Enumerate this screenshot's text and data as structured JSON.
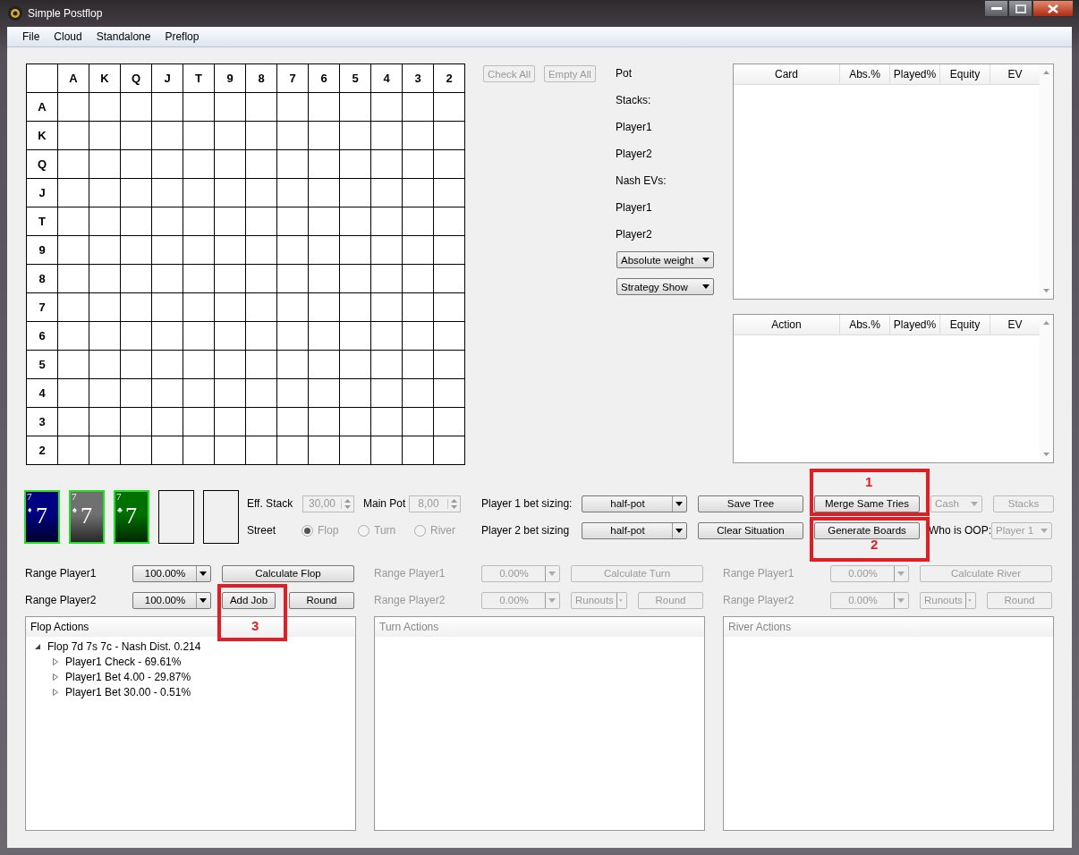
{
  "window": {
    "title": "Simple Postflop"
  },
  "menu": [
    "File",
    "Cloud",
    "Standalone",
    "Preflop"
  ],
  "grid": {
    "columns": [
      "A",
      "K",
      "Q",
      "J",
      "T",
      "9",
      "8",
      "7",
      "6",
      "5",
      "4",
      "3",
      "2"
    ],
    "rows": [
      "A",
      "K",
      "Q",
      "J",
      "T",
      "9",
      "8",
      "7",
      "6",
      "5",
      "4",
      "3",
      "2"
    ]
  },
  "grid_buttons": [
    {
      "label": "Check All",
      "disabled": true
    },
    {
      "label": "Empty All",
      "disabled": true
    }
  ],
  "info_labels": [
    "Pot",
    "Stacks:",
    "Player1",
    "Player2",
    "Nash EVs:",
    "Player1",
    "Player2"
  ],
  "view_dropdowns": [
    "Absolute weight",
    "Strategy Show"
  ],
  "card_table": {
    "columns": [
      "Card",
      "Abs.%",
      "Played%",
      "Equity",
      "EV"
    ]
  },
  "action_table": {
    "columns": [
      "Action",
      "Abs.%",
      "Played%",
      "Equity",
      "EV"
    ]
  },
  "board": [
    {
      "kind": "card",
      "corner": "7",
      "suit": "♦",
      "rank": "7",
      "color": "#000080"
    },
    {
      "kind": "card",
      "corner": "7",
      "suit": "♠",
      "rank": "7",
      "color": "#707070"
    },
    {
      "kind": "card",
      "corner": "7",
      "suit": "♣",
      "rank": "7",
      "color": "#007000"
    },
    {
      "kind": "empty"
    },
    {
      "kind": "empty"
    }
  ],
  "eff_stack": {
    "label": "Eff. Stack",
    "value": "30,00",
    "disabled": true
  },
  "main_pot": {
    "label": "Main Pot",
    "value": "8,00",
    "disabled": true
  },
  "street": {
    "label": "Street",
    "options": [
      {
        "label": "Flop",
        "selected": true,
        "disabled": true
      },
      {
        "label": "Turn",
        "selected": false,
        "disabled": true
      },
      {
        "label": "River",
        "selected": false,
        "disabled": true
      }
    ]
  },
  "bet_rows": [
    {
      "label": "Player 1 bet sizing:",
      "value": "half-pot",
      "button": "Save Tree",
      "board_button": "Merge Same Tries"
    },
    {
      "label": "Player 2 bet sizing",
      "value": "half-pot",
      "button": "Clear Situation",
      "board_button": "Generate Boards"
    }
  ],
  "game_type": {
    "value": "Cash",
    "disabled": true
  },
  "stacks_button": {
    "label": "Stacks",
    "disabled": true
  },
  "oop": {
    "label": "Who is OOP:",
    "value": "Player 1",
    "disabled": true
  },
  "streets": [
    {
      "disabled": false,
      "ranges": [
        {
          "label": "Range Player1",
          "value": "100.00%"
        },
        {
          "label": "Range Player2",
          "value": "100.00%"
        }
      ],
      "calculate": "Calculate Flop",
      "add_job": "Add Job",
      "round": "Round",
      "panel_title": "Flop Actions",
      "tree": [
        {
          "label": "Flop 7d 7s 7c - Nash Dist. 0.214",
          "expanded": true,
          "children": [
            {
              "label": "Player1 Check - 69.61%",
              "expanded": false
            },
            {
              "label": "Player1 Bet 4.00 - 29.87%",
              "expanded": false
            },
            {
              "label": "Player1 Bet 30.00 - 0.51%",
              "expanded": false
            }
          ]
        }
      ]
    },
    {
      "disabled": true,
      "ranges": [
        {
          "label": "Range Player1",
          "value": "0.00%"
        },
        {
          "label": "Range Player2",
          "value": "0.00%"
        }
      ],
      "calculate": "Calculate Turn",
      "runouts": "Runouts",
      "round": "Round",
      "panel_title": "Turn Actions"
    },
    {
      "disabled": true,
      "ranges": [
        {
          "label": "Range Player1",
          "value": "0.00%"
        },
        {
          "label": "Range Player2",
          "value": "0.00%"
        }
      ],
      "calculate": "Calculate River",
      "runouts": "Runouts",
      "round": "Round",
      "panel_title": "River Actions"
    }
  ],
  "annotations": [
    {
      "label": "1"
    },
    {
      "label": "2"
    },
    {
      "label": "3"
    }
  ]
}
